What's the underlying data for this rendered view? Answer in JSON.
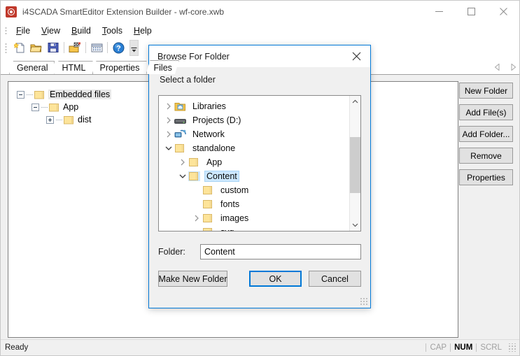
{
  "window": {
    "title": "i4SCADA SmartEditor Extension Builder - wf-core.xwb",
    "icon": "app-target-icon",
    "controls": {
      "minimize": "minimize-icon",
      "maximize": "maximize-icon",
      "close": "close-icon"
    }
  },
  "menu": {
    "items": [
      {
        "label": "File",
        "mnemonic": "F"
      },
      {
        "label": "View",
        "mnemonic": "V"
      },
      {
        "label": "Build",
        "mnemonic": "B"
      },
      {
        "label": "Tools",
        "mnemonic": "T"
      },
      {
        "label": "Help",
        "mnemonic": "H"
      }
    ]
  },
  "toolbar": {
    "buttons": [
      {
        "name": "new-file-icon"
      },
      {
        "name": "open-folder-icon"
      },
      {
        "name": "save-icon"
      },
      {
        "name": "build-icon"
      },
      {
        "name": "grid-icon"
      },
      {
        "name": "help-icon"
      }
    ],
    "overflow": "toolbar-overflow-icon"
  },
  "tabs": {
    "items": [
      {
        "label": "General",
        "active": false
      },
      {
        "label": "HTML",
        "active": false
      },
      {
        "label": "Properties",
        "active": false
      },
      {
        "label": "Files",
        "active": true
      }
    ],
    "scroll_left": "scroll-left-icon",
    "scroll_right": "scroll-right-icon"
  },
  "file_tree": {
    "nodes": [
      {
        "label": "Embedded files",
        "indent": 0,
        "state": "expanded",
        "selected": true
      },
      {
        "label": "App",
        "indent": 1,
        "state": "expanded",
        "selected": false
      },
      {
        "label": "dist",
        "indent": 2,
        "state": "collapsed",
        "selected": false
      }
    ]
  },
  "side_buttons": [
    {
      "label": "New Folder"
    },
    {
      "label": "Add File(s)"
    },
    {
      "label": "Add Folder..."
    },
    {
      "label": "Remove"
    },
    {
      "label": "Properties"
    }
  ],
  "statusbar": {
    "message": "Ready",
    "indicators": [
      {
        "label": "CAP",
        "active": false
      },
      {
        "label": "NUM",
        "active": true
      },
      {
        "label": "SCRL",
        "active": false
      }
    ]
  },
  "dialog": {
    "title": "Browse For Folder",
    "close_icon": "close-icon",
    "prompt": "Select a folder",
    "tree": {
      "nodes": [
        {
          "label": "Libraries",
          "indent": 0,
          "chevron": "right",
          "icon": "libraries-icon",
          "selected": false
        },
        {
          "label": "Projects (D:)",
          "indent": 0,
          "chevron": "right",
          "icon": "drive-icon",
          "selected": false
        },
        {
          "label": "Network",
          "indent": 0,
          "chevron": "right",
          "icon": "network-icon",
          "selected": false
        },
        {
          "label": "standalone",
          "indent": 0,
          "chevron": "down",
          "icon": "folder-icon",
          "selected": false
        },
        {
          "label": "App",
          "indent": 1,
          "chevron": "right",
          "icon": "folder-icon",
          "selected": false
        },
        {
          "label": "Content",
          "indent": 1,
          "chevron": "down",
          "icon": "folder-icon",
          "selected": true
        },
        {
          "label": "custom",
          "indent": 2,
          "chevron": "none",
          "icon": "folder-icon",
          "selected": false
        },
        {
          "label": "fonts",
          "indent": 2,
          "chevron": "none",
          "icon": "folder-icon",
          "selected": false
        },
        {
          "label": "images",
          "indent": 2,
          "chevron": "right",
          "icon": "folder-icon",
          "selected": false
        },
        {
          "label": "svg",
          "indent": 2,
          "chevron": "none",
          "icon": "folder-icon",
          "selected": false
        }
      ],
      "scrollbar": {
        "up": "scroll-up-icon",
        "down": "scroll-down-icon"
      }
    },
    "folder_field": {
      "label": "Folder:",
      "value": "Content",
      "placeholder": ""
    },
    "buttons": {
      "make_new_folder": "Make New Folder",
      "ok": "OK",
      "cancel": "Cancel"
    }
  },
  "colors": {
    "accent": "#0078d7",
    "selection": "#cde8ff",
    "folder": "#fde49a",
    "button_face": "#e1e1e1"
  }
}
